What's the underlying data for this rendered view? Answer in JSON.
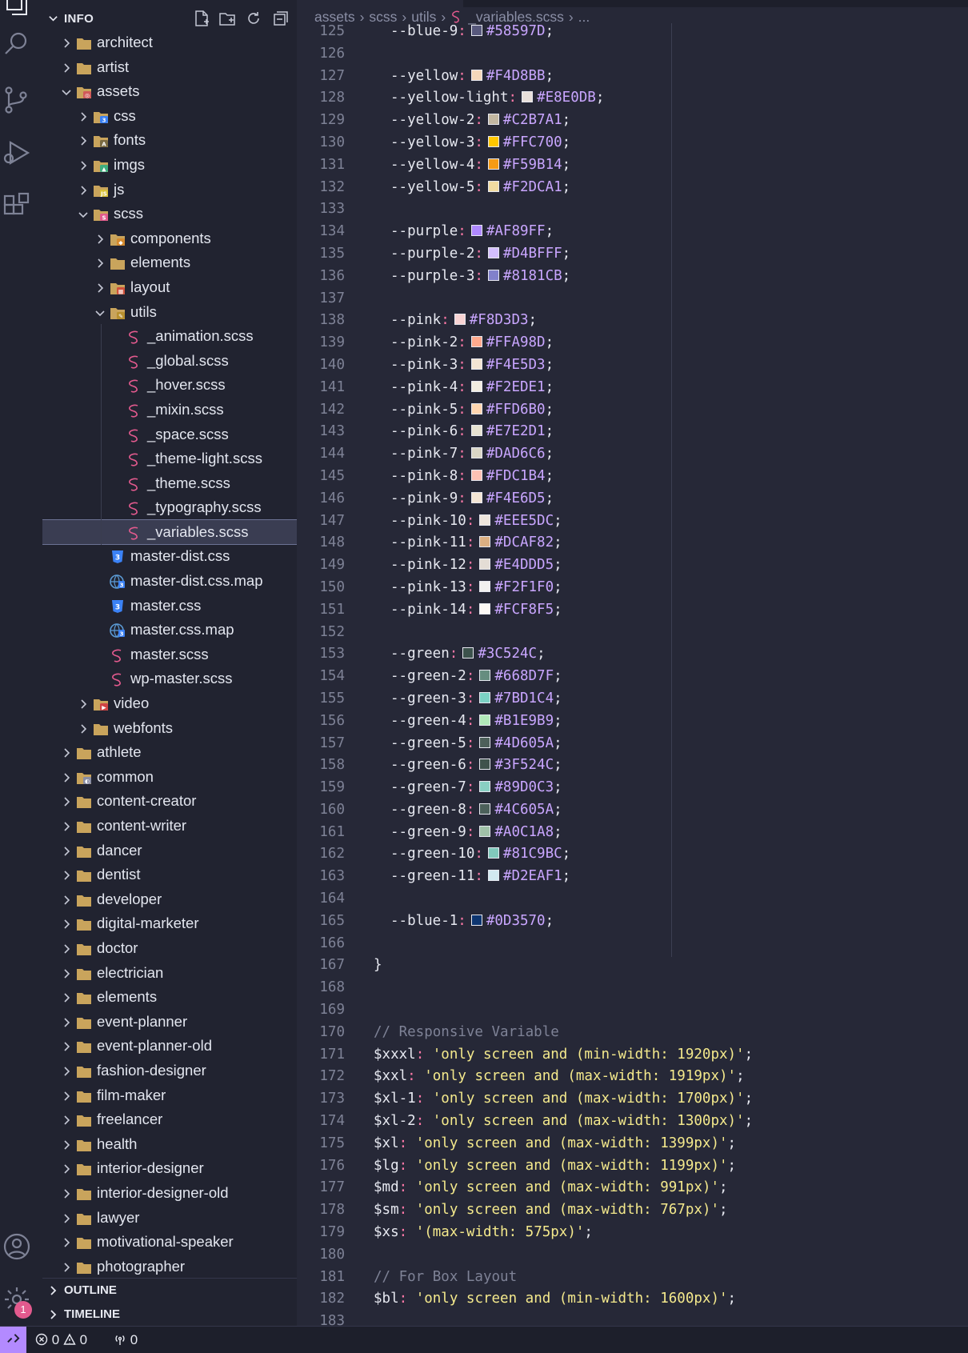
{
  "sidebar": {
    "title": "INFO",
    "tree": [
      {
        "label": "architect",
        "depth": 0,
        "type": "folder",
        "open": false
      },
      {
        "label": "artist",
        "depth": 0,
        "type": "folder",
        "open": false
      },
      {
        "label": "assets",
        "depth": 0,
        "type": "folder-assets",
        "open": true
      },
      {
        "label": "css",
        "depth": 1,
        "type": "folder-css",
        "open": false
      },
      {
        "label": "fonts",
        "depth": 1,
        "type": "folder-fonts",
        "open": false
      },
      {
        "label": "imgs",
        "depth": 1,
        "type": "folder-imgs",
        "open": false
      },
      {
        "label": "js",
        "depth": 1,
        "type": "folder-js",
        "open": false
      },
      {
        "label": "scss",
        "depth": 1,
        "type": "folder-scss",
        "open": true
      },
      {
        "label": "components",
        "depth": 2,
        "type": "folder-components",
        "open": false
      },
      {
        "label": "elements",
        "depth": 2,
        "type": "folder",
        "open": false
      },
      {
        "label": "layout",
        "depth": 2,
        "type": "folder-layout",
        "open": false
      },
      {
        "label": "utils",
        "depth": 2,
        "type": "folder-utils",
        "open": true
      },
      {
        "label": "_animation.scss",
        "depth": 3,
        "type": "scss"
      },
      {
        "label": "_global.scss",
        "depth": 3,
        "type": "scss"
      },
      {
        "label": "_hover.scss",
        "depth": 3,
        "type": "scss"
      },
      {
        "label": "_mixin.scss",
        "depth": 3,
        "type": "scss"
      },
      {
        "label": "_space.scss",
        "depth": 3,
        "type": "scss"
      },
      {
        "label": "_theme-light.scss",
        "depth": 3,
        "type": "scss"
      },
      {
        "label": "_theme.scss",
        "depth": 3,
        "type": "scss"
      },
      {
        "label": "_typography.scss",
        "depth": 3,
        "type": "scss"
      },
      {
        "label": "_variables.scss",
        "depth": 3,
        "type": "scss",
        "selected": true
      },
      {
        "label": "master-dist.css",
        "depth": 2,
        "type": "css"
      },
      {
        "label": "master-dist.css.map",
        "depth": 2,
        "type": "map"
      },
      {
        "label": "master.css",
        "depth": 2,
        "type": "css"
      },
      {
        "label": "master.css.map",
        "depth": 2,
        "type": "map"
      },
      {
        "label": "master.scss",
        "depth": 2,
        "type": "scss"
      },
      {
        "label": "wp-master.scss",
        "depth": 2,
        "type": "scss"
      },
      {
        "label": "video",
        "depth": 1,
        "type": "folder-video",
        "open": false
      },
      {
        "label": "webfonts",
        "depth": 1,
        "type": "folder",
        "open": false
      },
      {
        "label": "athlete",
        "depth": 0,
        "type": "folder",
        "open": false
      },
      {
        "label": "common",
        "depth": 0,
        "type": "folder-common",
        "open": false
      },
      {
        "label": "content-creator",
        "depth": 0,
        "type": "folder",
        "open": false
      },
      {
        "label": "content-writer",
        "depth": 0,
        "type": "folder",
        "open": false
      },
      {
        "label": "dancer",
        "depth": 0,
        "type": "folder",
        "open": false
      },
      {
        "label": "dentist",
        "depth": 0,
        "type": "folder",
        "open": false
      },
      {
        "label": "developer",
        "depth": 0,
        "type": "folder",
        "open": false
      },
      {
        "label": "digital-marketer",
        "depth": 0,
        "type": "folder",
        "open": false
      },
      {
        "label": "doctor",
        "depth": 0,
        "type": "folder",
        "open": false
      },
      {
        "label": "electrician",
        "depth": 0,
        "type": "folder",
        "open": false
      },
      {
        "label": "elements",
        "depth": 0,
        "type": "folder",
        "open": false
      },
      {
        "label": "event-planner",
        "depth": 0,
        "type": "folder",
        "open": false
      },
      {
        "label": "event-planner-old",
        "depth": 0,
        "type": "folder",
        "open": false
      },
      {
        "label": "fashion-designer",
        "depth": 0,
        "type": "folder",
        "open": false
      },
      {
        "label": "film-maker",
        "depth": 0,
        "type": "folder",
        "open": false
      },
      {
        "label": "freelancer",
        "depth": 0,
        "type": "folder",
        "open": false
      },
      {
        "label": "health",
        "depth": 0,
        "type": "folder",
        "open": false
      },
      {
        "label": "interior-designer",
        "depth": 0,
        "type": "folder",
        "open": false
      },
      {
        "label": "interior-designer-old",
        "depth": 0,
        "type": "folder",
        "open": false
      },
      {
        "label": "lawyer",
        "depth": 0,
        "type": "folder",
        "open": false
      },
      {
        "label": "motivational-speaker",
        "depth": 0,
        "type": "folder",
        "open": false
      },
      {
        "label": "photographer",
        "depth": 0,
        "type": "folder",
        "open": false
      }
    ],
    "panels": [
      "OUTLINE",
      "TIMELINE"
    ]
  },
  "breadcrumbs": [
    "assets",
    "scss",
    "utils",
    "_variables.scss",
    "..."
  ],
  "code": [
    {
      "n": "125",
      "k": "var",
      "name": "--blue-9",
      "hex": "#58597D",
      "c": "#58597D"
    },
    {
      "n": "126",
      "k": "blank"
    },
    {
      "n": "127",
      "k": "var",
      "name": "--yellow",
      "hex": "#F4D8BB",
      "c": "#F4D8BB"
    },
    {
      "n": "128",
      "k": "var",
      "name": "--yellow-light",
      "hex": "#E8E0DB",
      "c": "#E8E0DB"
    },
    {
      "n": "129",
      "k": "var",
      "name": "--yellow-2",
      "hex": "#C2B7A1",
      "c": "#C2B7A1"
    },
    {
      "n": "130",
      "k": "var",
      "name": "--yellow-3",
      "hex": "#FFC700",
      "c": "#FFC700"
    },
    {
      "n": "131",
      "k": "var",
      "name": "--yellow-4",
      "hex": "#F59B14",
      "c": "#F59B14"
    },
    {
      "n": "132",
      "k": "var",
      "name": "--yellow-5",
      "hex": "#F2DCA1",
      "c": "#F2DCA1"
    },
    {
      "n": "133",
      "k": "blank"
    },
    {
      "n": "134",
      "k": "var",
      "name": "--purple",
      "hex": "#AF89FF",
      "c": "#AF89FF"
    },
    {
      "n": "135",
      "k": "var",
      "name": "--purple-2",
      "hex": "#D4BFFF",
      "c": "#D4BFFF"
    },
    {
      "n": "136",
      "k": "var",
      "name": "--purple-3",
      "hex": "#8181CB",
      "c": "#8181CB"
    },
    {
      "n": "137",
      "k": "blank"
    },
    {
      "n": "138",
      "k": "var",
      "name": "--pink",
      "hex": "#F8D3D3",
      "c": "#F8D3D3"
    },
    {
      "n": "139",
      "k": "var",
      "name": "--pink-2",
      "hex": "#FFA98D",
      "c": "#FFA98D"
    },
    {
      "n": "140",
      "k": "var",
      "name": "--pink-3",
      "hex": "#F4E5D3",
      "c": "#F4E5D3"
    },
    {
      "n": "141",
      "k": "var",
      "name": "--pink-4",
      "hex": "#F2EDE1",
      "c": "#F2EDE1"
    },
    {
      "n": "142",
      "k": "var",
      "name": "--pink-5",
      "hex": "#FFD6B0",
      "c": "#FFD6B0"
    },
    {
      "n": "143",
      "k": "var",
      "name": "--pink-6",
      "hex": "#E7E2D1",
      "c": "#E7E2D1"
    },
    {
      "n": "144",
      "k": "var",
      "name": "--pink-7",
      "hex": "#DAD6C6",
      "c": "#DAD6C6"
    },
    {
      "n": "145",
      "k": "var",
      "name": "--pink-8",
      "hex": "#FDC1B4",
      "c": "#FDC1B4"
    },
    {
      "n": "146",
      "k": "var",
      "name": "--pink-9",
      "hex": "#F4E6D5",
      "c": "#F4E6D5"
    },
    {
      "n": "147",
      "k": "var",
      "name": "--pink-10",
      "hex": "#EEE5DC",
      "c": "#EEE5DC"
    },
    {
      "n": "148",
      "k": "var",
      "name": "--pink-11",
      "hex": "#DCAF82",
      "c": "#DCAF82"
    },
    {
      "n": "149",
      "k": "var",
      "name": "--pink-12",
      "hex": "#E4DDD5",
      "c": "#E4DDD5"
    },
    {
      "n": "150",
      "k": "var",
      "name": "--pink-13",
      "hex": "#F2F1F0",
      "c": "#F2F1F0"
    },
    {
      "n": "151",
      "k": "var",
      "name": "--pink-14",
      "hex": "#FCF8F5",
      "c": "#FCF8F5"
    },
    {
      "n": "152",
      "k": "blank"
    },
    {
      "n": "153",
      "k": "var",
      "name": "--green",
      "hex": "#3C524C",
      "c": "#3C524C"
    },
    {
      "n": "154",
      "k": "var",
      "name": "--green-2",
      "hex": "#668D7F",
      "c": "#668D7F"
    },
    {
      "n": "155",
      "k": "var",
      "name": "--green-3",
      "hex": "#7BD1C4",
      "c": "#7BD1C4"
    },
    {
      "n": "156",
      "k": "var",
      "name": "--green-4",
      "hex": "#B1E9B9",
      "c": "#B1E9B9"
    },
    {
      "n": "157",
      "k": "var",
      "name": "--green-5",
      "hex": "#4D605A",
      "c": "#4D605A"
    },
    {
      "n": "158",
      "k": "var",
      "name": "--green-6",
      "hex": "#3F524C",
      "c": "#3F524C"
    },
    {
      "n": "159",
      "k": "var",
      "name": "--green-7",
      "hex": "#89D0C3",
      "c": "#89D0C3"
    },
    {
      "n": "160",
      "k": "var",
      "name": "--green-8",
      "hex": "#4C605A",
      "c": "#4C605A"
    },
    {
      "n": "161",
      "k": "var",
      "name": "--green-9",
      "hex": "#A0C1A8",
      "c": "#A0C1A8"
    },
    {
      "n": "162",
      "k": "var",
      "name": "--green-10",
      "hex": "#81C9BC",
      "c": "#81C9BC"
    },
    {
      "n": "163",
      "k": "var",
      "name": "--green-11",
      "hex": "#D2EAF1",
      "c": "#D2EAF1"
    },
    {
      "n": "164",
      "k": "blank"
    },
    {
      "n": "165",
      "k": "var",
      "name": "--blue-1",
      "hex": "#0D3570",
      "c": "#0D3570"
    },
    {
      "n": "166",
      "k": "blank"
    },
    {
      "n": "167",
      "k": "brace",
      "text": "}"
    },
    {
      "n": "168",
      "k": "blank"
    },
    {
      "n": "169",
      "k": "blank"
    },
    {
      "n": "170",
      "k": "comment",
      "text": "// Responsive Variable"
    },
    {
      "n": "171",
      "k": "svar",
      "name": "$xxxl",
      "str": "'only screen and (min-width: 1920px)'"
    },
    {
      "n": "172",
      "k": "svar",
      "name": "$xxl",
      "str": "'only screen and (max-width: 1919px)'"
    },
    {
      "n": "173",
      "k": "svar",
      "name": "$xl-1",
      "str": "'only screen and (max-width: 1700px)'"
    },
    {
      "n": "174",
      "k": "svar",
      "name": "$xl-2",
      "str": "'only screen and (max-width: 1300px)'"
    },
    {
      "n": "175",
      "k": "svar",
      "name": "$xl",
      "str": "'only screen and (max-width: 1399px)'"
    },
    {
      "n": "176",
      "k": "svar",
      "name": "$lg",
      "str": "'only screen and (max-width: 1199px)'"
    },
    {
      "n": "177",
      "k": "svar",
      "name": "$md",
      "str": "'only screen and (max-width: 991px)'"
    },
    {
      "n": "178",
      "k": "svar",
      "name": "$sm",
      "str": "'only screen and (max-width: 767px)'"
    },
    {
      "n": "179",
      "k": "svar",
      "name": "$xs",
      "str": "'(max-width: 575px)'"
    },
    {
      "n": "180",
      "k": "blank"
    },
    {
      "n": "181",
      "k": "comment",
      "text": "// For Box Layout"
    },
    {
      "n": "182",
      "k": "svar",
      "name": "$bl",
      "str": "'only screen and (min-width: 1600px)'"
    },
    {
      "n": "183",
      "k": "blank"
    }
  ],
  "status": {
    "errors": "0",
    "warnings": "0",
    "ports": "0"
  },
  "accounts_badge": "1",
  "icons": {
    "activity": [
      "explorer-icon",
      "search-icon",
      "source-control-icon",
      "run-debug-icon",
      "extensions-icon",
      "account-icon",
      "settings-gear-icon"
    ],
    "header": [
      "new-file-icon",
      "new-folder-icon",
      "refresh-icon",
      "collapse-all-icon"
    ]
  },
  "colors": {
    "accent": "#b38aff",
    "folder": "#c9a45c",
    "scss": "#e35a8e",
    "css": "#3b82f6"
  }
}
